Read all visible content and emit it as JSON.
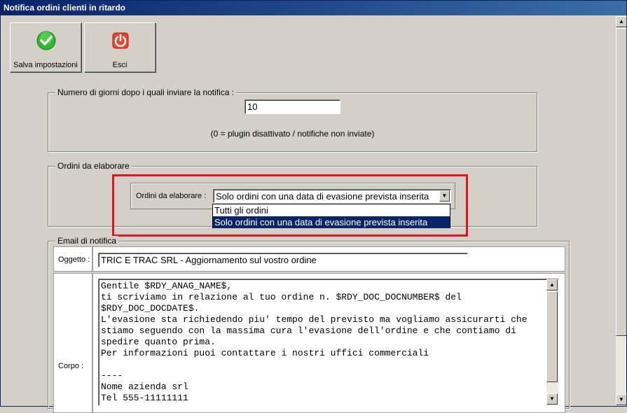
{
  "window": {
    "title": "Notifica ordini clienti in ritardo"
  },
  "toolbar": {
    "save_label": "Salva impostazioni",
    "exit_label": "Esci"
  },
  "days_group": {
    "title": "Numero di giorni dopo i quali inviare la notifica :",
    "value": "10",
    "hint": "(0 = plugin disattivato / notifiche non inviate)"
  },
  "orders_group": {
    "title": "Ordini da elaborare",
    "field_label": "Ordini da elaborare :",
    "selected": "Solo ordini con una data di evasione prevista inserita",
    "options": [
      "Tutti gli ordini",
      "Solo ordini con una data di evasione prevista inserita"
    ]
  },
  "email_group": {
    "title": "Email di notifica",
    "subject_label": "Oggetto :",
    "subject_value": "TRIC E TRAC SRL - Aggiornamento sul vostro ordine",
    "body_label": "Corpo :",
    "body_value": "Gentile $RDY_ANAG_NAME$,\nti scriviamo in relazione al tuo ordine n. $RDY_DOC_DOCNUMBER$ del\n$RDY_DOC_DOCDATE$.\nL'evasione sta richiedendo piu' tempo del previsto ma vogliamo assicurarti che\nstiamo seguendo con la massima cura l'evasione dell'ordine e che contiamo di\nspedire quanto prima.\nPer informazioni puoi contattare i nostri uffici commerciali\n\n----\nNome azienda srl\nTel 555-11111111"
  },
  "colors": {
    "highlight": "#e0141e",
    "titlebar": "#0a246a",
    "selection": "#0a246a"
  }
}
